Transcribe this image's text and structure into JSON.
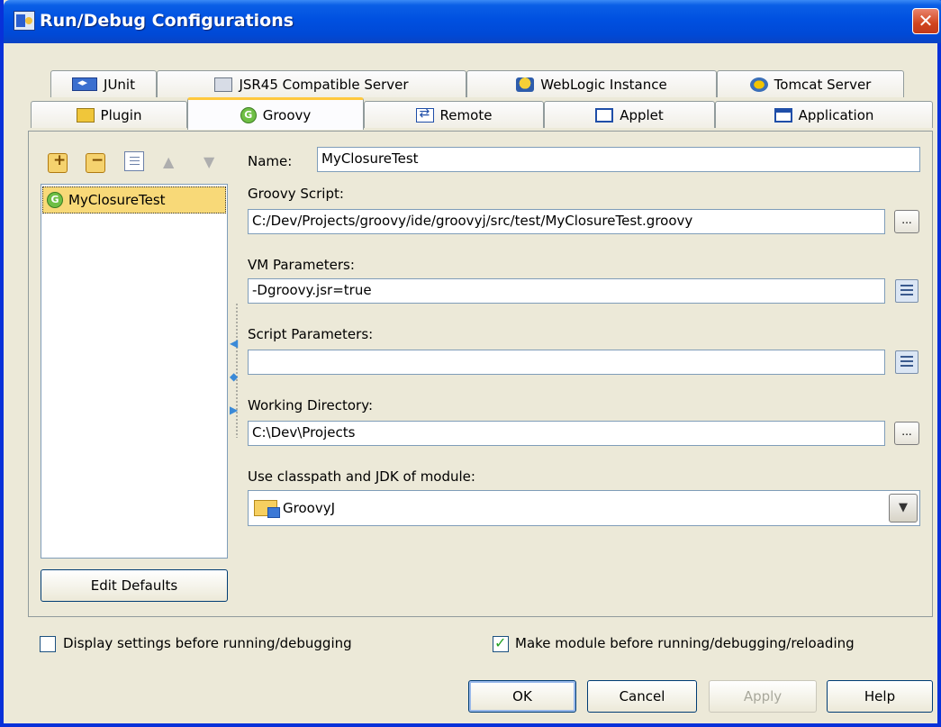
{
  "window": {
    "title": "Run/Debug Configurations",
    "close_label": "✕"
  },
  "tabs_row1": [
    "JUnit",
    "JSR45 Compatible Server",
    "WebLogic Instance",
    "Tomcat Server"
  ],
  "tabs_row2": [
    "Plugin",
    "Groovy",
    "Remote",
    "Applet",
    "Application"
  ],
  "active_tab": "Groovy",
  "config_list": {
    "items": [
      "MyClosureTest"
    ],
    "selected": "MyClosureTest"
  },
  "edit_defaults_label": "Edit Defaults",
  "form": {
    "name_label": "Name:",
    "name_value": "MyClosureTest",
    "groovy_script_label": "Groovy Script:",
    "groovy_script_value": "C:/Dev/Projects/groovy/ide/groovyj/src/test/MyClosureTest.groovy",
    "vm_params_label": "VM Parameters:",
    "vm_params_value": "-Dgroovy.jsr=true",
    "script_params_label": "Script Parameters:",
    "script_params_value": "",
    "working_dir_label": "Working Directory:",
    "working_dir_value": "C:\\Dev\\Projects",
    "module_label": "Use classpath and JDK of module:",
    "module_value": "GroovyJ",
    "browse_label": "..."
  },
  "options": {
    "display_settings_label": "Display settings before running/debugging",
    "display_settings_checked": false,
    "make_module_label": "Make module before running/debugging/reloading",
    "make_module_checked": true
  },
  "buttons": {
    "ok": "OK",
    "cancel": "Cancel",
    "apply": "Apply",
    "help": "Help"
  }
}
